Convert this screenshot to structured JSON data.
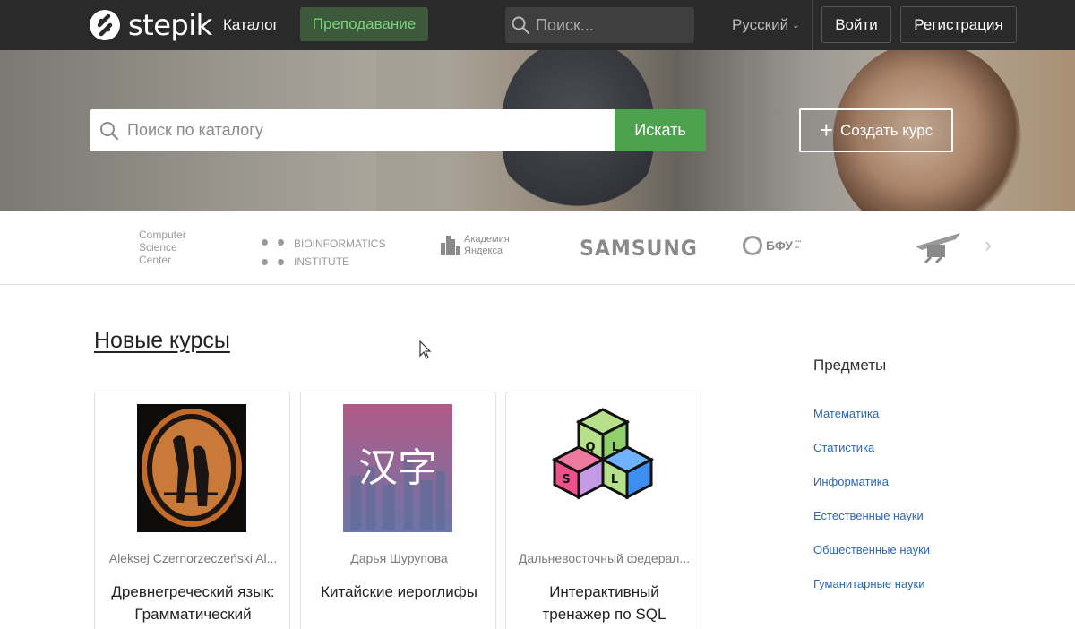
{
  "header": {
    "logo_text": "stepik",
    "catalog_label": "Каталог",
    "teaching_label": "Преподавание",
    "search_placeholder": "Поиск...",
    "language_label": "Русский",
    "login_label": "Войти",
    "register_label": "Регистрация"
  },
  "hero": {
    "search_placeholder": "Поиск по каталогу",
    "search_button": "Искать",
    "create_course_label": "Создать курс"
  },
  "partners": {
    "csc_lines": [
      "Computer",
      "Science",
      "Center"
    ],
    "bioinformatics_lines": [
      "BIOINFORMATICS",
      "INSTITUTE"
    ],
    "yandex_lines": [
      "Академия",
      "Яндекса"
    ],
    "samsung": "SAMSUNG",
    "bfu": "БФУ"
  },
  "main": {
    "section_title": "Новые курсы",
    "courses": [
      {
        "author": "Aleksej Czernorzeczeński Al...",
        "title": "Древнегреческий язык: Грамматический"
      },
      {
        "author": "Дарья Шурупова",
        "title": "Китайские иероглифы",
        "cover_text": "汉字"
      },
      {
        "author": "Дальневосточный федерал...",
        "title": "Интерактивный тренажер по SQL",
        "cover_letters": [
          "Q",
          "L",
          "S",
          "L"
        ]
      }
    ]
  },
  "sidebar": {
    "title": "Предметы",
    "items": [
      {
        "label": "Математика"
      },
      {
        "label": "Статистика"
      },
      {
        "label": "Информатика"
      },
      {
        "label": "Естественные науки"
      },
      {
        "label": "Общественные науки"
      },
      {
        "label": "Гуманитарные науки"
      }
    ]
  },
  "colors": {
    "topbar_bg": "#2a2a2a",
    "accent_green": "#4ea14e",
    "teach_text": "#7bd17a",
    "link_blue": "#2c67b6"
  }
}
